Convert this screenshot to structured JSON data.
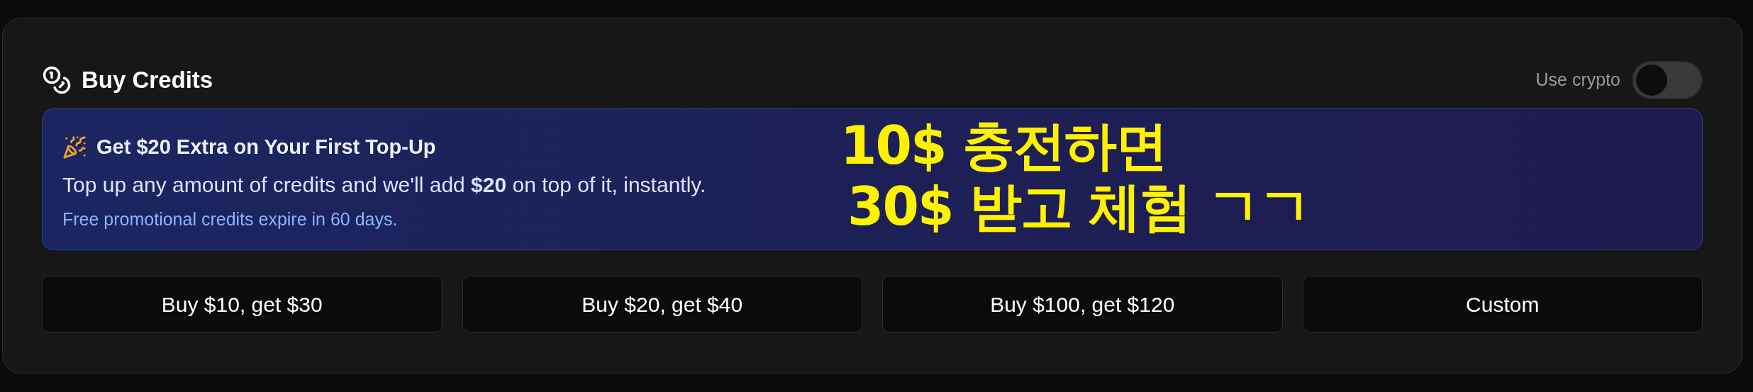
{
  "header": {
    "title": "Buy Credits",
    "crypto_toggle": {
      "label": "Use crypto",
      "on": false
    }
  },
  "promo": {
    "title": "Get $20 Extra on Your First Top-Up",
    "body": "Top up any amount of credits and we'll add **$20** on top of it, instantly.",
    "note": "Free promotional credits expire in 60 days."
  },
  "overlay_text": [
    "10$ 충전하면",
    "30$ 받고 체험 ㄱㄱ"
  ],
  "buttons": [
    "Buy $10, get $30",
    "Buy $20, get $40",
    "Buy $100, get $120",
    "Custom"
  ]
}
